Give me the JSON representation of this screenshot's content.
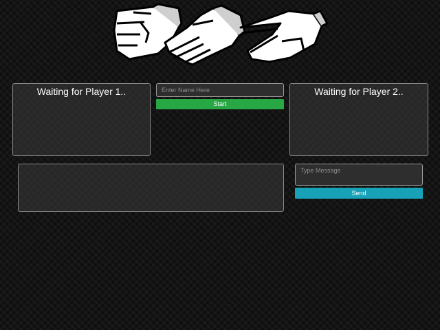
{
  "header": {
    "logo_icon": "rock-paper-scissors-hands-icon"
  },
  "players": {
    "player1_status": "Waiting for Player 1..",
    "player2_status": "Waiting for Player 2.."
  },
  "name_form": {
    "placeholder": "Enter Name Here",
    "start_label": "Start"
  },
  "chat": {
    "message_placeholder": "Type Message",
    "send_label": "Send"
  },
  "colors": {
    "start_button": "#28a745",
    "send_button": "#17a2b8",
    "background": "#141414"
  }
}
